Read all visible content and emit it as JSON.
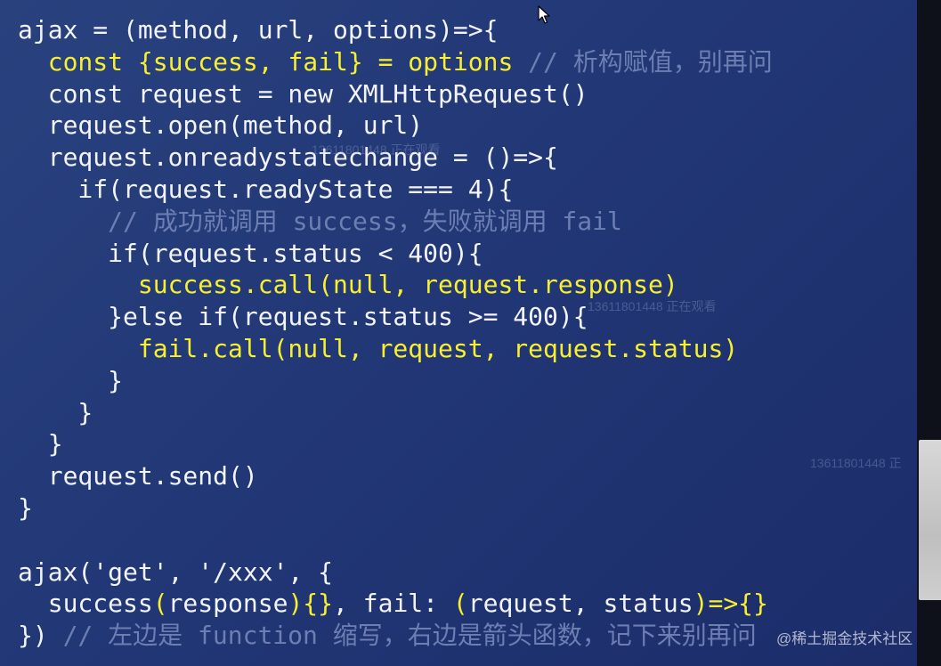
{
  "code": {
    "lines": [
      [
        {
          "t": "ajax = (method, url, options)=>{",
          "c": "plain"
        }
      ],
      [
        {
          "t": "  ",
          "c": "plain"
        },
        {
          "t": "const {success, fail} = options",
          "c": "yellow"
        },
        {
          "t": " // 析构赋值，别再问",
          "c": "comment"
        }
      ],
      [
        {
          "t": "  const request = new XMLHttpRequest()",
          "c": "plain"
        }
      ],
      [
        {
          "t": "  request.open(method, url)",
          "c": "plain"
        }
      ],
      [
        {
          "t": "  request.onreadystatechange = ()=>{",
          "c": "plain"
        }
      ],
      [
        {
          "t": "    if(request.readyState === 4){",
          "c": "plain"
        }
      ],
      [
        {
          "t": "      // 成功就调用 success，失败就调用 fail",
          "c": "comment"
        }
      ],
      [
        {
          "t": "      if(request.status < 400){",
          "c": "plain"
        }
      ],
      [
        {
          "t": "        ",
          "c": "plain"
        },
        {
          "t": "success.call(null, request.response)",
          "c": "yellow"
        }
      ],
      [
        {
          "t": "      }else if(request.status >= 400){",
          "c": "plain"
        }
      ],
      [
        {
          "t": "        ",
          "c": "plain"
        },
        {
          "t": "fail.call(null, request, request.status)",
          "c": "yellow"
        }
      ],
      [
        {
          "t": "      }",
          "c": "plain"
        }
      ],
      [
        {
          "t": "    }",
          "c": "plain"
        }
      ],
      [
        {
          "t": "  }",
          "c": "plain"
        }
      ],
      [
        {
          "t": "  request.send()",
          "c": "plain"
        }
      ],
      [
        {
          "t": "}",
          "c": "plain"
        }
      ],
      [
        {
          "t": "",
          "c": "plain"
        }
      ],
      [
        {
          "t": "ajax('get', '/xxx', {",
          "c": "plain"
        }
      ],
      [
        {
          "t": "  success",
          "c": "plain"
        },
        {
          "t": "(",
          "c": "yellow"
        },
        {
          "t": "response",
          "c": "plain"
        },
        {
          "t": "){}",
          "c": "yellow"
        },
        {
          "t": ", fail: ",
          "c": "plain"
        },
        {
          "t": "(",
          "c": "yellow"
        },
        {
          "t": "request, status",
          "c": "plain"
        },
        {
          "t": ")=>{}",
          "c": "yellow"
        }
      ],
      [
        {
          "t": "}) ",
          "c": "plain"
        },
        {
          "t": "// 左边是 function 缩写，右边是箭头函数，记下来别再问",
          "c": "comment"
        }
      ]
    ]
  },
  "watermarks": {
    "viewer_1": "13611801448 正在观看",
    "viewer_2": "13611801448 正在观看",
    "viewer_3": "13611801448 正"
  },
  "footer": {
    "brand": "@稀土掘金技术社区"
  },
  "icons": {
    "cursor": "mouse-pointer-icon"
  },
  "colors": {
    "background": "#223776",
    "plain_text": "#f2f4fa",
    "highlight": "#f7ef2f",
    "comment": "#6c7eb2"
  }
}
